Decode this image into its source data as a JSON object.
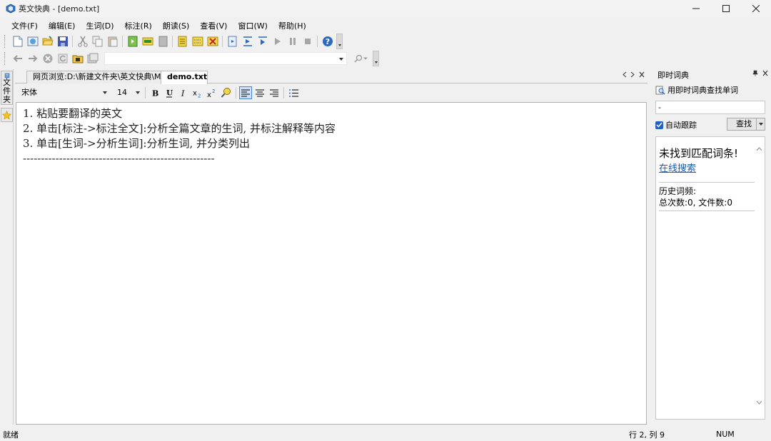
{
  "window": {
    "title": "英文快典 - [demo.txt]",
    "controls": [
      "minimize",
      "maximize",
      "close"
    ]
  },
  "menu": {
    "items": [
      "文件(F)",
      "编辑(E)",
      "生词(D)",
      "标注(R)",
      "朗读(S)",
      "查看(V)",
      "窗口(W)",
      "帮助(H)"
    ]
  },
  "toolbar1": {
    "icons": [
      "new-file-icon",
      "open-web-icon",
      "open-folder-icon",
      "save-icon",
      "cut-icon",
      "copy-icon",
      "paste-icon",
      "mark-icon",
      "mark-all-icon",
      "clear-icon",
      "words-icon",
      "word-list-icon",
      "remove-mark-icon",
      "read-start-icon",
      "read-line-icon",
      "read-next-icon",
      "play-icon",
      "pause-icon",
      "stop-icon",
      "help-icon"
    ]
  },
  "toolbar2": {
    "address_value": "",
    "icons": [
      "back-icon",
      "forward-icon",
      "stop-nav-icon",
      "refresh-icon",
      "folder-icon",
      "web-icon",
      "search-icon"
    ]
  },
  "left_sidebar": {
    "files_label": "文件夹"
  },
  "document": {
    "tabs": [
      {
        "label": "网页浏览:D:\\新建文件夹\\英文快典\\M..",
        "active": false
      },
      {
        "label": "demo.txt",
        "active": true
      }
    ],
    "font": "宋体",
    "size": "14",
    "lines": [
      "1. 粘贴要翻译的英文",
      "2. 单击[标注->标注全文]:分析全篇文章的生词, 并标注解释等内容",
      "3. 单击[生词->分析生词]:分析生词, 并分类列出",
      "-----------------------------------------------------"
    ]
  },
  "dict_panel": {
    "title": "即时词典",
    "lookup_title": "用即时词典查找单词",
    "input_value": "-",
    "auto_track_label": "自动跟踪",
    "auto_track_checked": true,
    "lookup_button": "查找",
    "not_found": "未找到匹配词条!",
    "online_search": "在线搜索",
    "history_title": "历史词频:",
    "history_stats": "总次数:0, 文件数:0"
  },
  "status": {
    "ready": "就绪",
    "position": "行 2, 列 9",
    "num": "NUM"
  },
  "colors": {
    "accent": "#2060c8",
    "link": "#1a5ab0"
  }
}
